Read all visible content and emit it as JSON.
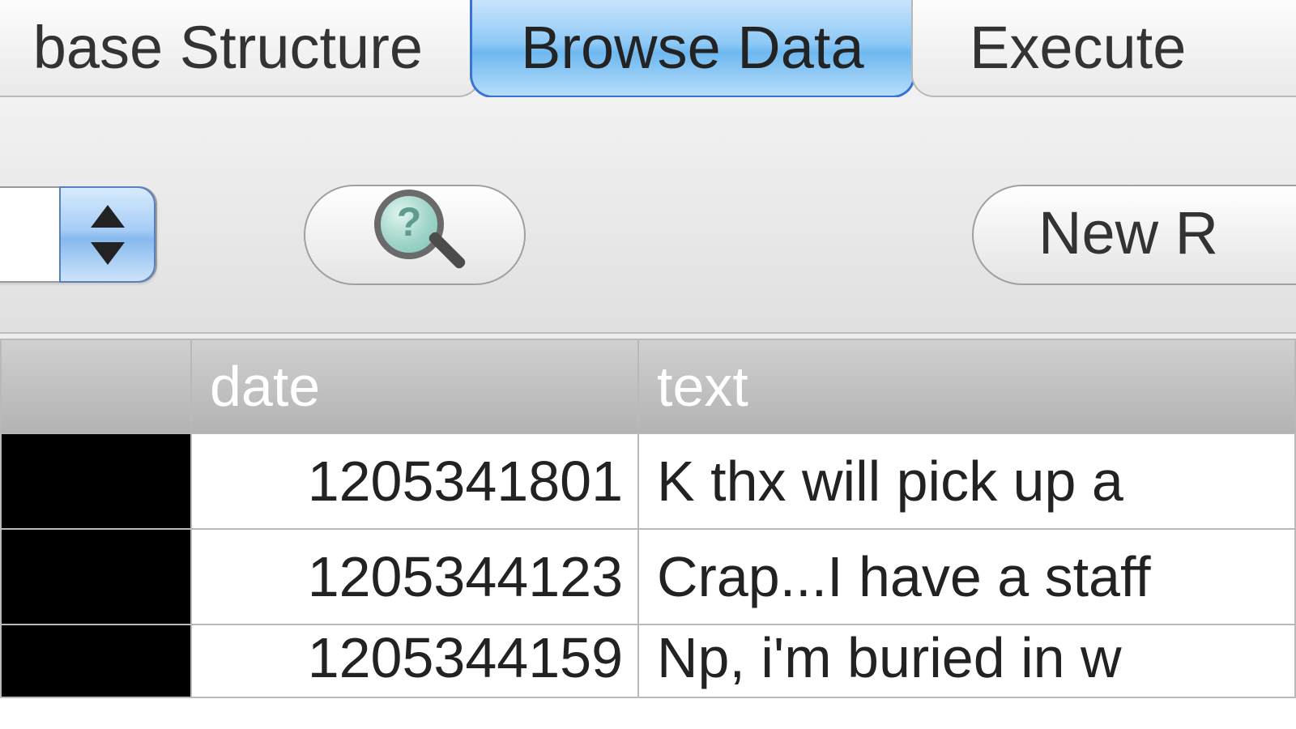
{
  "tabs": {
    "left": "base Structure",
    "active": "Browse Data",
    "right": "Execute "
  },
  "toolbar": {
    "table_select_value": "",
    "new_record_label": "New R"
  },
  "table": {
    "columns": {
      "c0": "",
      "c1": "date",
      "c2": "text"
    },
    "rows": [
      {
        "c0": "",
        "c1": "1205341801",
        "c2": "K thx will pick up a"
      },
      {
        "c0": "",
        "c1": "1205344123",
        "c2": "Crap...I have a staff"
      },
      {
        "c0": "",
        "c1": "1205344159",
        "c2": "Np, i'm buried in w"
      }
    ]
  }
}
